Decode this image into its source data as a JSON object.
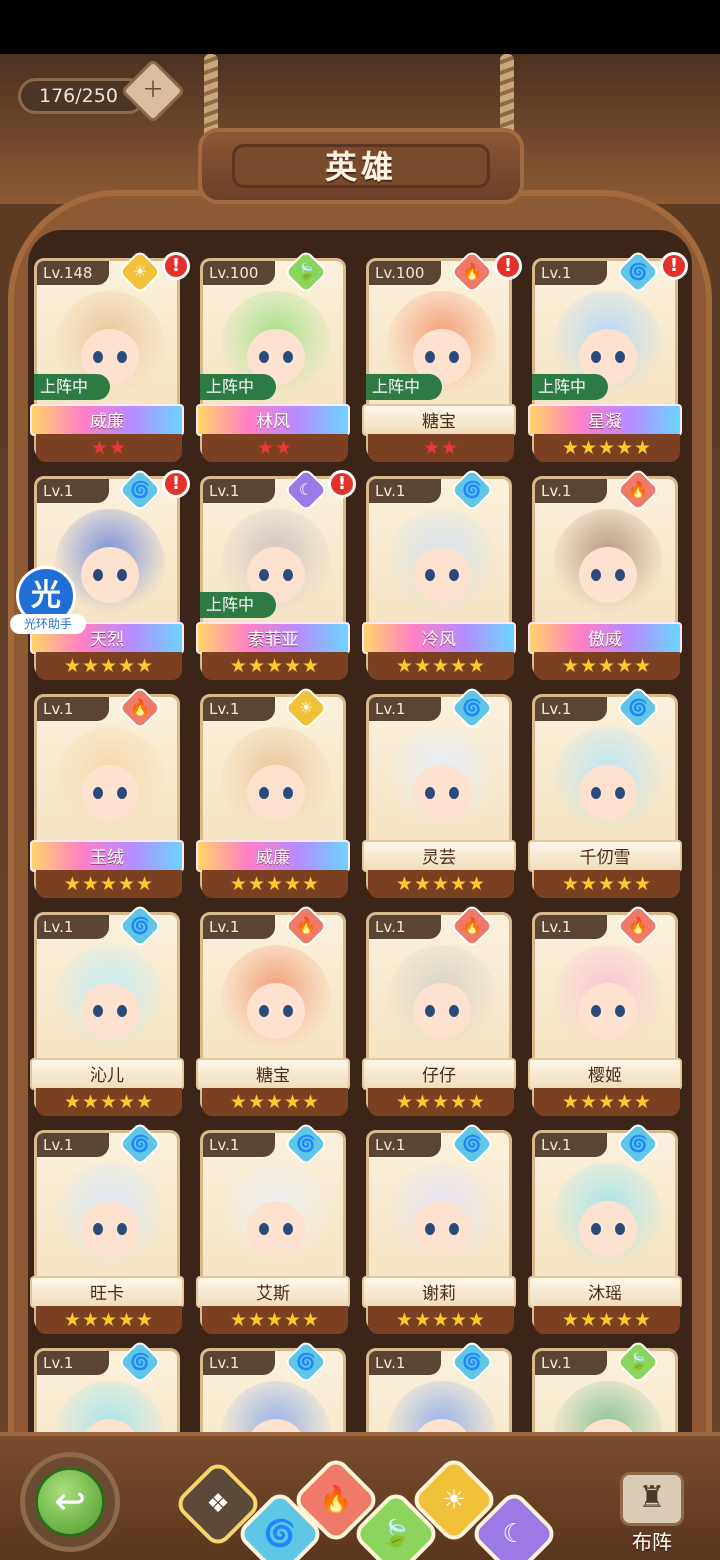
{
  "header": {
    "counter": "176/250",
    "title": "英雄"
  },
  "colors": {
    "light": "#f2c13a",
    "water": "#5fc6e6",
    "fire": "#f07a68",
    "wood": "#8bd45e",
    "dark": "#9b7ae6"
  },
  "cards": [
    {
      "level": "Lv.148",
      "element": "light",
      "alert": "!",
      "deployed": "上阵中",
      "name": "威廉",
      "stars": "★★",
      "star_count": 2,
      "ribbon": "rainbow"
    },
    {
      "level": "Lv.100",
      "element": "wood",
      "alert": "",
      "deployed": "上阵中",
      "name": "林风",
      "stars": "★★",
      "star_count": 2,
      "ribbon": "rainbow"
    },
    {
      "level": "Lv.100",
      "element": "fire",
      "alert": "!",
      "deployed": "上阵中",
      "name": "糖宝",
      "stars": "★★",
      "star_count": 2,
      "ribbon": "plain"
    },
    {
      "level": "Lv.1",
      "element": "water",
      "alert": "!",
      "deployed": "上阵中",
      "name": "星凝",
      "stars": "★★★★★",
      "star_count": 5,
      "ribbon": "rainbow"
    },
    {
      "level": "Lv.1",
      "element": "water",
      "alert": "!",
      "deployed": "",
      "name": "天烈",
      "stars": "★★★★★",
      "star_count": 5,
      "ribbon": "rainbow"
    },
    {
      "level": "Lv.1",
      "element": "dark",
      "alert": "!",
      "deployed": "上阵中",
      "name": "索菲亚",
      "stars": "★★★★★",
      "star_count": 5,
      "ribbon": "rainbow"
    },
    {
      "level": "Lv.1",
      "element": "water",
      "alert": "",
      "deployed": "",
      "name": "冷风",
      "stars": "★★★★★",
      "star_count": 5,
      "ribbon": "rainbow"
    },
    {
      "level": "Lv.1",
      "element": "fire",
      "alert": "",
      "deployed": "",
      "name": "傲威",
      "stars": "★★★★★",
      "star_count": 5,
      "ribbon": "rainbow"
    },
    {
      "level": "Lv.1",
      "element": "fire",
      "alert": "",
      "deployed": "",
      "name": "玉绒",
      "stars": "★★★★★",
      "star_count": 5,
      "ribbon": "rainbow"
    },
    {
      "level": "Lv.1",
      "element": "light",
      "alert": "",
      "deployed": "",
      "name": "威廉",
      "stars": "★★★★★",
      "star_count": 5,
      "ribbon": "rainbow"
    },
    {
      "level": "Lv.1",
      "element": "water",
      "alert": "",
      "deployed": "",
      "name": "灵芸",
      "stars": "★★★★★",
      "star_count": 5,
      "ribbon": "plain"
    },
    {
      "level": "Lv.1",
      "element": "water",
      "alert": "",
      "deployed": "",
      "name": "千仞雪",
      "stars": "★★★★★",
      "star_count": 5,
      "ribbon": "plain"
    },
    {
      "level": "Lv.1",
      "element": "water",
      "alert": "",
      "deployed": "",
      "name": "沁儿",
      "stars": "★★★★★",
      "star_count": 5,
      "ribbon": "plain"
    },
    {
      "level": "Lv.1",
      "element": "fire",
      "alert": "",
      "deployed": "",
      "name": "糖宝",
      "stars": "★★★★★",
      "star_count": 5,
      "ribbon": "plain"
    },
    {
      "level": "Lv.1",
      "element": "fire",
      "alert": "",
      "deployed": "",
      "name": "仔仔",
      "stars": "★★★★★",
      "star_count": 5,
      "ribbon": "plain"
    },
    {
      "level": "Lv.1",
      "element": "fire",
      "alert": "",
      "deployed": "",
      "name": "樱姬",
      "stars": "★★★★★",
      "star_count": 5,
      "ribbon": "plain"
    },
    {
      "level": "Lv.1",
      "element": "water",
      "alert": "",
      "deployed": "",
      "name": "旺卡",
      "stars": "★★★★★",
      "star_count": 5,
      "ribbon": "plain"
    },
    {
      "level": "Lv.1",
      "element": "water",
      "alert": "",
      "deployed": "",
      "name": "艾斯",
      "stars": "★★★★★",
      "star_count": 5,
      "ribbon": "plain"
    },
    {
      "level": "Lv.1",
      "element": "water",
      "alert": "",
      "deployed": "",
      "name": "谢莉",
      "stars": "★★★★★",
      "star_count": 5,
      "ribbon": "plain"
    },
    {
      "level": "Lv.1",
      "element": "water",
      "alert": "",
      "deployed": "",
      "name": "沐瑶",
      "stars": "★★★★★",
      "star_count": 5,
      "ribbon": "plain"
    },
    {
      "level": "Lv.1",
      "element": "water",
      "alert": "",
      "deployed": "",
      "name": "",
      "stars": "",
      "star_count": 0,
      "ribbon": "none"
    },
    {
      "level": "Lv.1",
      "element": "water",
      "alert": "",
      "deployed": "",
      "name": "",
      "stars": "",
      "star_count": 0,
      "ribbon": "none"
    },
    {
      "level": "Lv.1",
      "element": "water",
      "alert": "",
      "deployed": "",
      "name": "",
      "stars": "",
      "star_count": 0,
      "ribbon": "none"
    },
    {
      "level": "Lv.1",
      "element": "wood",
      "alert": "",
      "deployed": "",
      "name": "",
      "stars": "",
      "star_count": 0,
      "ribbon": "none"
    }
  ],
  "assistant": {
    "glyph": "光",
    "label": "光环助手"
  },
  "bottom": {
    "back_glyph": "↩",
    "filters": [
      {
        "element": "all",
        "glyph": "❖"
      },
      {
        "element": "water",
        "glyph": "🌀"
      },
      {
        "element": "fire",
        "glyph": "🔥"
      },
      {
        "element": "wood",
        "glyph": "🍃"
      },
      {
        "element": "light",
        "glyph": "☀"
      },
      {
        "element": "dark",
        "glyph": "☾"
      }
    ],
    "formation_label": "布阵",
    "formation_glyph": "♜"
  }
}
